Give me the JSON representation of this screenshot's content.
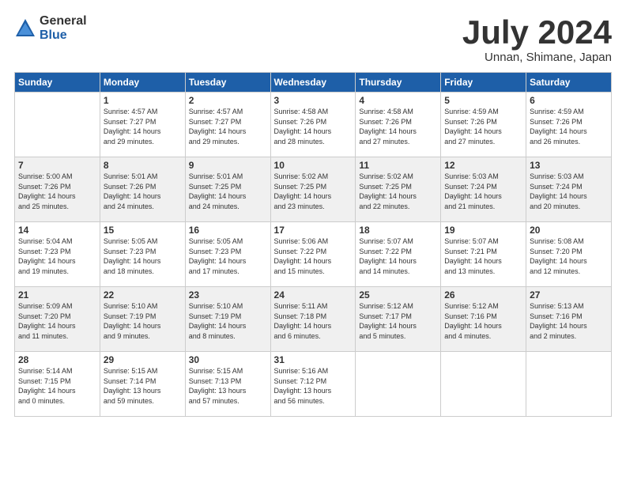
{
  "header": {
    "logo_general": "General",
    "logo_blue": "Blue",
    "month_title": "July 2024",
    "location": "Unnan, Shimane, Japan"
  },
  "days_of_week": [
    "Sunday",
    "Monday",
    "Tuesday",
    "Wednesday",
    "Thursday",
    "Friday",
    "Saturday"
  ],
  "weeks": [
    [
      {
        "day": "",
        "info": ""
      },
      {
        "day": "1",
        "info": "Sunrise: 4:57 AM\nSunset: 7:27 PM\nDaylight: 14 hours\nand 29 minutes."
      },
      {
        "day": "2",
        "info": "Sunrise: 4:57 AM\nSunset: 7:27 PM\nDaylight: 14 hours\nand 29 minutes."
      },
      {
        "day": "3",
        "info": "Sunrise: 4:58 AM\nSunset: 7:26 PM\nDaylight: 14 hours\nand 28 minutes."
      },
      {
        "day": "4",
        "info": "Sunrise: 4:58 AM\nSunset: 7:26 PM\nDaylight: 14 hours\nand 27 minutes."
      },
      {
        "day": "5",
        "info": "Sunrise: 4:59 AM\nSunset: 7:26 PM\nDaylight: 14 hours\nand 27 minutes."
      },
      {
        "day": "6",
        "info": "Sunrise: 4:59 AM\nSunset: 7:26 PM\nDaylight: 14 hours\nand 26 minutes."
      }
    ],
    [
      {
        "day": "7",
        "info": "Sunrise: 5:00 AM\nSunset: 7:26 PM\nDaylight: 14 hours\nand 25 minutes."
      },
      {
        "day": "8",
        "info": "Sunrise: 5:01 AM\nSunset: 7:26 PM\nDaylight: 14 hours\nand 24 minutes."
      },
      {
        "day": "9",
        "info": "Sunrise: 5:01 AM\nSunset: 7:25 PM\nDaylight: 14 hours\nand 24 minutes."
      },
      {
        "day": "10",
        "info": "Sunrise: 5:02 AM\nSunset: 7:25 PM\nDaylight: 14 hours\nand 23 minutes."
      },
      {
        "day": "11",
        "info": "Sunrise: 5:02 AM\nSunset: 7:25 PM\nDaylight: 14 hours\nand 22 minutes."
      },
      {
        "day": "12",
        "info": "Sunrise: 5:03 AM\nSunset: 7:24 PM\nDaylight: 14 hours\nand 21 minutes."
      },
      {
        "day": "13",
        "info": "Sunrise: 5:03 AM\nSunset: 7:24 PM\nDaylight: 14 hours\nand 20 minutes."
      }
    ],
    [
      {
        "day": "14",
        "info": "Sunrise: 5:04 AM\nSunset: 7:23 PM\nDaylight: 14 hours\nand 19 minutes."
      },
      {
        "day": "15",
        "info": "Sunrise: 5:05 AM\nSunset: 7:23 PM\nDaylight: 14 hours\nand 18 minutes."
      },
      {
        "day": "16",
        "info": "Sunrise: 5:05 AM\nSunset: 7:23 PM\nDaylight: 14 hours\nand 17 minutes."
      },
      {
        "day": "17",
        "info": "Sunrise: 5:06 AM\nSunset: 7:22 PM\nDaylight: 14 hours\nand 15 minutes."
      },
      {
        "day": "18",
        "info": "Sunrise: 5:07 AM\nSunset: 7:22 PM\nDaylight: 14 hours\nand 14 minutes."
      },
      {
        "day": "19",
        "info": "Sunrise: 5:07 AM\nSunset: 7:21 PM\nDaylight: 14 hours\nand 13 minutes."
      },
      {
        "day": "20",
        "info": "Sunrise: 5:08 AM\nSunset: 7:20 PM\nDaylight: 14 hours\nand 12 minutes."
      }
    ],
    [
      {
        "day": "21",
        "info": "Sunrise: 5:09 AM\nSunset: 7:20 PM\nDaylight: 14 hours\nand 11 minutes."
      },
      {
        "day": "22",
        "info": "Sunrise: 5:10 AM\nSunset: 7:19 PM\nDaylight: 14 hours\nand 9 minutes."
      },
      {
        "day": "23",
        "info": "Sunrise: 5:10 AM\nSunset: 7:19 PM\nDaylight: 14 hours\nand 8 minutes."
      },
      {
        "day": "24",
        "info": "Sunrise: 5:11 AM\nSunset: 7:18 PM\nDaylight: 14 hours\nand 6 minutes."
      },
      {
        "day": "25",
        "info": "Sunrise: 5:12 AM\nSunset: 7:17 PM\nDaylight: 14 hours\nand 5 minutes."
      },
      {
        "day": "26",
        "info": "Sunrise: 5:12 AM\nSunset: 7:16 PM\nDaylight: 14 hours\nand 4 minutes."
      },
      {
        "day": "27",
        "info": "Sunrise: 5:13 AM\nSunset: 7:16 PM\nDaylight: 14 hours\nand 2 minutes."
      }
    ],
    [
      {
        "day": "28",
        "info": "Sunrise: 5:14 AM\nSunset: 7:15 PM\nDaylight: 14 hours\nand 0 minutes."
      },
      {
        "day": "29",
        "info": "Sunrise: 5:15 AM\nSunset: 7:14 PM\nDaylight: 13 hours\nand 59 minutes."
      },
      {
        "day": "30",
        "info": "Sunrise: 5:15 AM\nSunset: 7:13 PM\nDaylight: 13 hours\nand 57 minutes."
      },
      {
        "day": "31",
        "info": "Sunrise: 5:16 AM\nSunset: 7:12 PM\nDaylight: 13 hours\nand 56 minutes."
      },
      {
        "day": "",
        "info": ""
      },
      {
        "day": "",
        "info": ""
      },
      {
        "day": "",
        "info": ""
      }
    ]
  ]
}
